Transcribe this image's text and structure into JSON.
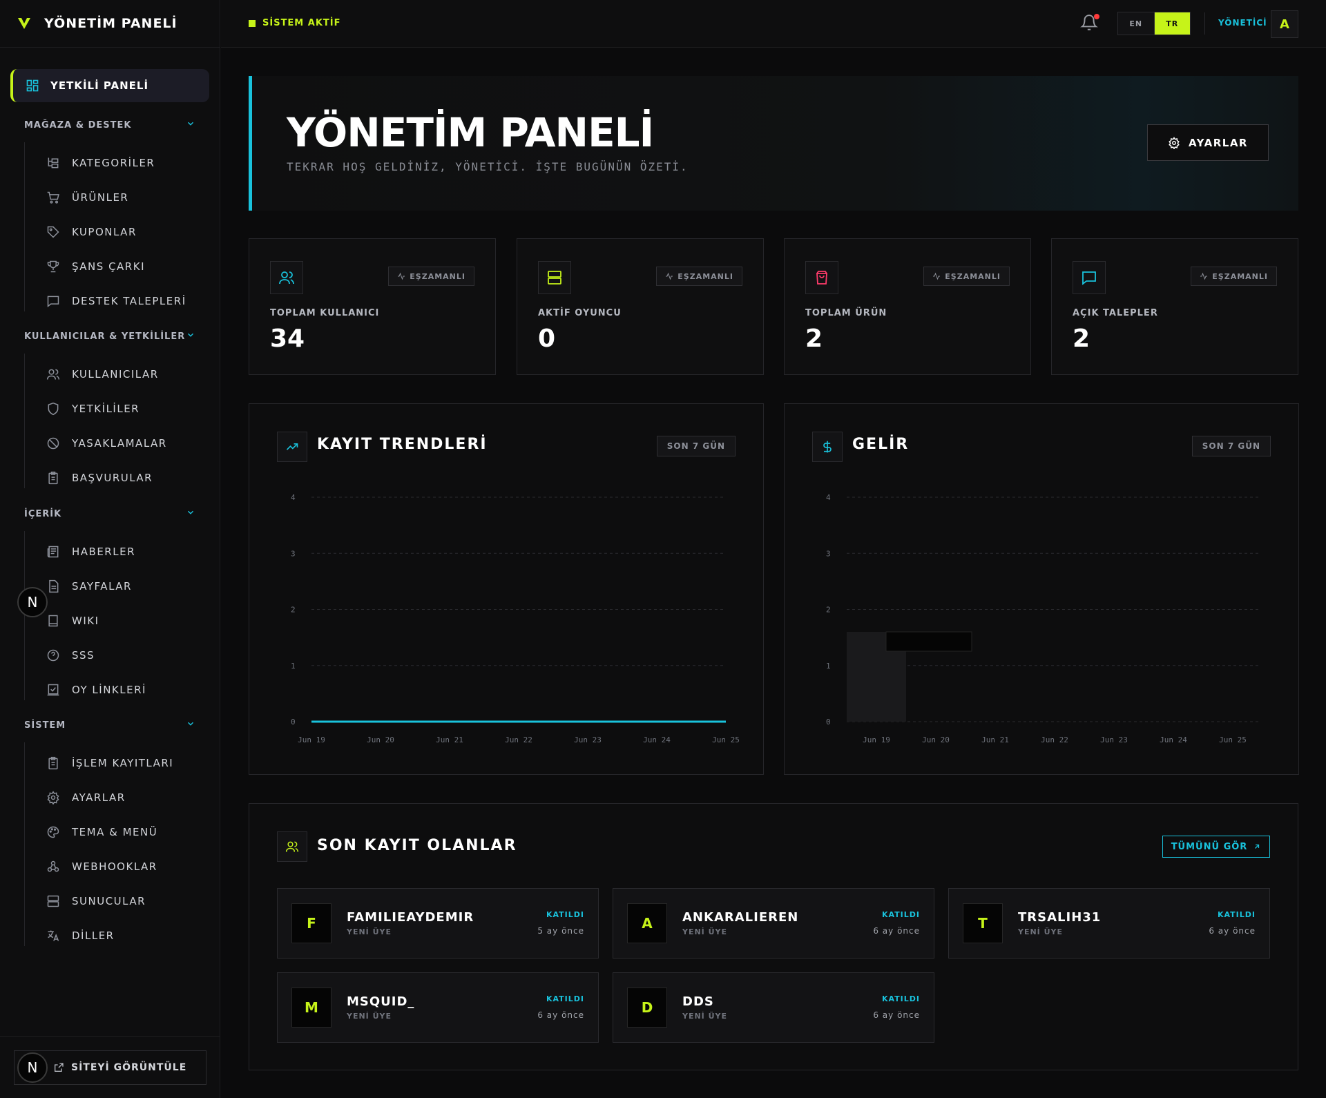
{
  "brand": {
    "title": "YÖNETİM PANELİ"
  },
  "topbar": {
    "status": "SİSTEM AKTİF",
    "lang_en": "EN",
    "lang_tr": "TR",
    "role": "YÖNETİCİ",
    "avatar": "A"
  },
  "sidebar": {
    "active": "YETKİLİ PANELİ",
    "groups": [
      {
        "title": "MAĞAZA & DESTEK",
        "items": [
          "KATEGORİLER",
          "ÜRÜNLER",
          "KUPONLAR",
          "ŞANS ÇARKI",
          "DESTEK TALEPLERİ"
        ]
      },
      {
        "title": "KULLANICILAR & YETKİLİLER",
        "items": [
          "KULLANICILAR",
          "YETKİLİLER",
          "YASAKLAMALAR",
          "BAŞVURULAR"
        ]
      },
      {
        "title": "İÇERİK",
        "items": [
          "HABERLER",
          "SAYFALAR",
          "WIKI",
          "SSS",
          "OY LİNKLERİ"
        ]
      },
      {
        "title": "SİSTEM",
        "items": [
          "İŞLEM KAYITLARI",
          "AYARLAR",
          "TEMA & MENÜ",
          "WEBHOOKLAR",
          "SUNUCULAR",
          "DİLLER"
        ]
      }
    ],
    "view_site": "SİTEYİ GÖRÜNTÜLE",
    "n_badge": "N"
  },
  "hero": {
    "title": "YÖNETİM PANELİ",
    "subtitle": "TEKRAR HOŞ GELDİNİZ, YÖNETİCİ. İŞTE BUGÜNÜN ÖZETİ.",
    "settings": "AYARLAR"
  },
  "stats": [
    {
      "label": "TOPLAM KULLANICI",
      "value": "34",
      "tag": "EŞZAMANLI",
      "icon": "users-icon",
      "color": "#19c2dc"
    },
    {
      "label": "AKTİF OYUNCU",
      "value": "0",
      "tag": "EŞZAMANLI",
      "icon": "server-icon",
      "color": "#c6f319"
    },
    {
      "label": "TOPLAM ÜRÜN",
      "value": "2",
      "tag": "EŞZAMANLI",
      "icon": "bag-icon",
      "color": "#ff3b6b"
    },
    {
      "label": "AÇIK TALEPLER",
      "value": "2",
      "tag": "EŞZAMANLI",
      "icon": "message-icon",
      "color": "#19c2dc"
    }
  ],
  "charts": {
    "registrations": {
      "title": "KAYIT TRENDLERİ",
      "range": "SON 7 GÜN"
    },
    "revenue": {
      "title": "GELİR",
      "range": "SON 7 GÜN"
    }
  },
  "chart_data": [
    {
      "type": "line",
      "title": "KAYIT TRENDLERİ",
      "categories": [
        "Jun 19",
        "Jun 20",
        "Jun 21",
        "Jun 22",
        "Jun 23",
        "Jun 24",
        "Jun 25"
      ],
      "series": [
        {
          "values": [
            0,
            0,
            0,
            0,
            0,
            0,
            0
          ]
        }
      ],
      "yticks": [
        0,
        1,
        2,
        3,
        4
      ],
      "ylim": [
        0,
        4
      ],
      "grid": true,
      "color": "#19c2dc"
    },
    {
      "type": "bar",
      "title": "GELİR",
      "categories": [
        "Jun 19",
        "Jun 20",
        "Jun 21",
        "Jun 22",
        "Jun 23",
        "Jun 24",
        "Jun 25"
      ],
      "series": [
        {
          "values": [
            0,
            0,
            0,
            0,
            0,
            0,
            0
          ]
        }
      ],
      "yticks": [
        0,
        1,
        2,
        3,
        4
      ],
      "ylim": [
        0,
        4
      ],
      "grid": true,
      "highlight_index": 0
    }
  ],
  "recent": {
    "title": "SON KAYIT OLANLAR",
    "view_all": "TÜMÜNÜ GÖR",
    "members": [
      {
        "initial": "F",
        "name": "FAMILIEAYDEMIR",
        "sub": "YENİ ÜYE",
        "joined": "KATILDI",
        "time": "5 ay önce"
      },
      {
        "initial": "A",
        "name": "ANKARALIEREN",
        "sub": "YENİ ÜYE",
        "joined": "KATILDI",
        "time": "6 ay önce"
      },
      {
        "initial": "T",
        "name": "TRSALIH31",
        "sub": "YENİ ÜYE",
        "joined": "KATILDI",
        "time": "6 ay önce"
      },
      {
        "initial": "M",
        "name": "MSQUID_",
        "sub": "YENİ ÜYE",
        "joined": "KATILDI",
        "time": "6 ay önce"
      },
      {
        "initial": "D",
        "name": "DDS",
        "sub": "YENİ ÜYE",
        "joined": "KATILDI",
        "time": "6 ay önce"
      }
    ]
  }
}
